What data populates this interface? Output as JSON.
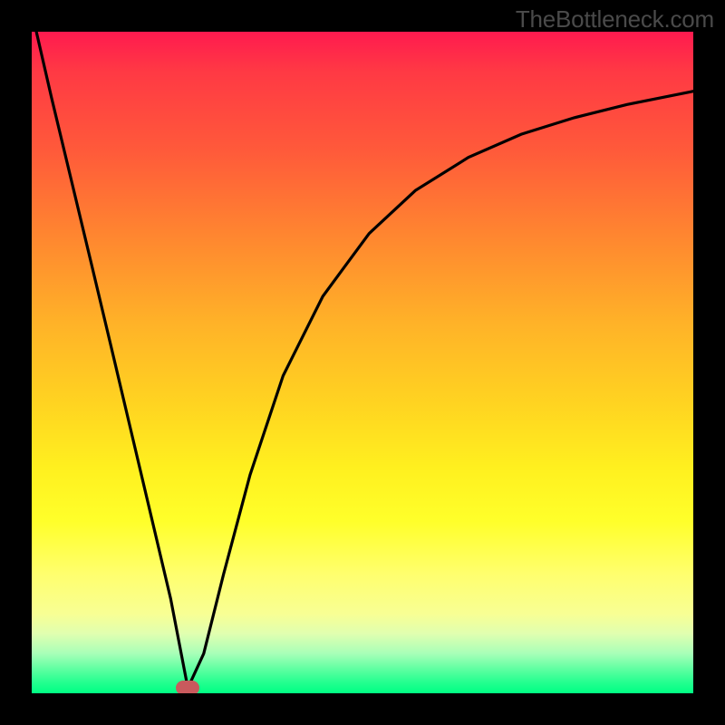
{
  "attribution": "TheBottleneck.com",
  "colors": {
    "frame": "#000000",
    "curve": "#000000",
    "dot": "#c95a5d",
    "gradient_top": "#ff1a4f",
    "gradient_bottom": "#00ff84"
  },
  "chart_data": {
    "type": "line",
    "title": "",
    "xlabel": "",
    "ylabel": "",
    "xlim": [
      0,
      100
    ],
    "ylim": [
      0,
      100
    ],
    "axes_visible": false,
    "grid": false,
    "legend": false,
    "background": "red-to-green vertical gradient",
    "series": [
      {
        "name": "left-branch",
        "description": "steep near-linear descent from top-left corner to minimum",
        "x": [
          0.7,
          3,
          6,
          9,
          12,
          15,
          18,
          21,
          23.6
        ],
        "y": [
          100,
          90,
          77.5,
          65,
          52.4,
          39.7,
          27,
          14.3,
          0.8
        ]
      },
      {
        "name": "right-branch",
        "description": "concave-increasing curve from minimum rising toward top-right, approaching asymptote below 100",
        "x": [
          23.6,
          26,
          29,
          33,
          38,
          44,
          51,
          58,
          66,
          74,
          82,
          90,
          100
        ],
        "y": [
          0.8,
          6,
          18,
          33,
          48,
          60,
          69.5,
          76,
          81,
          84.5,
          87,
          89,
          91
        ]
      }
    ],
    "annotations": [
      {
        "name": "minimum-point-marker",
        "shape": "rounded-pill",
        "x": 23.6,
        "y": 0.8,
        "color": "#c95a5d"
      }
    ]
  }
}
